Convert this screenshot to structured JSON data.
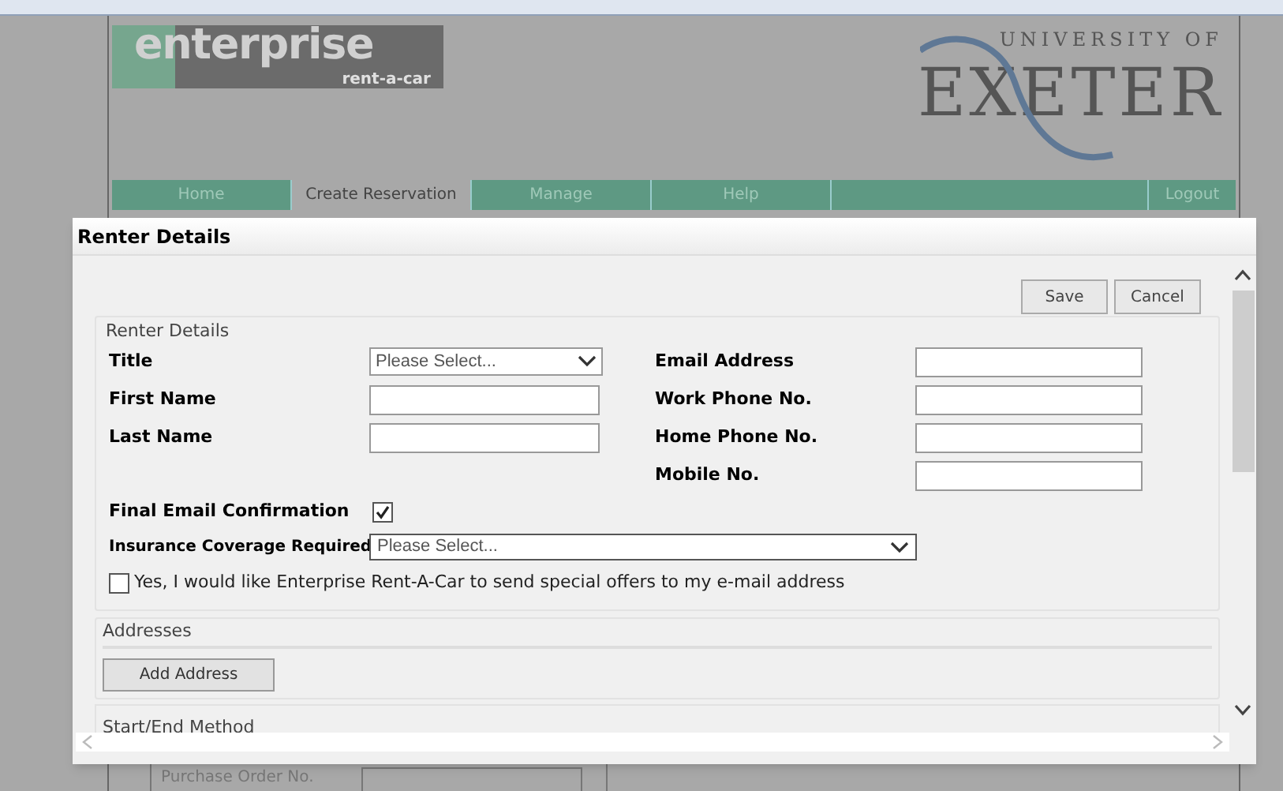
{
  "header": {
    "brand": "enterprise",
    "brand_sub": "rent-a-car",
    "university_top": "UNIVERSITY OF",
    "university_name": "EXETER"
  },
  "nav": [
    {
      "label": "Home",
      "selected": false
    },
    {
      "label": "Create Reservation",
      "selected": true
    },
    {
      "label": "Manage",
      "selected": false
    },
    {
      "label": "Help",
      "selected": false
    },
    {
      "label": "Logout",
      "selected": false
    }
  ],
  "dialog": {
    "title": "Renter Details",
    "buttons": [
      "Save",
      "Cancel"
    ],
    "section_title": "Renter Details",
    "left_fields": [
      {
        "label": "Title",
        "kind": "select",
        "placeholder": "Please Select..."
      },
      {
        "label": "First Name",
        "kind": "text"
      },
      {
        "label": "Last Name",
        "kind": "text"
      }
    ],
    "right_fields": [
      {
        "label": "Email Address"
      },
      {
        "label": "Work Phone No."
      },
      {
        "label": "Home Phone No."
      },
      {
        "label": "Mobile No."
      }
    ],
    "confirmation": {
      "label": "Final Email Confirmation",
      "checked": true
    },
    "insurance": {
      "label": "Insurance Coverage Required",
      "placeholder": "Please Select..."
    },
    "offers": {
      "label": "Yes, I would like Enterprise Rent-A-Car to send special offers to my e-mail address",
      "checked": false
    },
    "addresses": {
      "title": "Addresses",
      "button": "Add Address"
    },
    "start_end": {
      "title": "Start/End Method"
    }
  },
  "background_field": {
    "label": "Purchase Order No."
  }
}
